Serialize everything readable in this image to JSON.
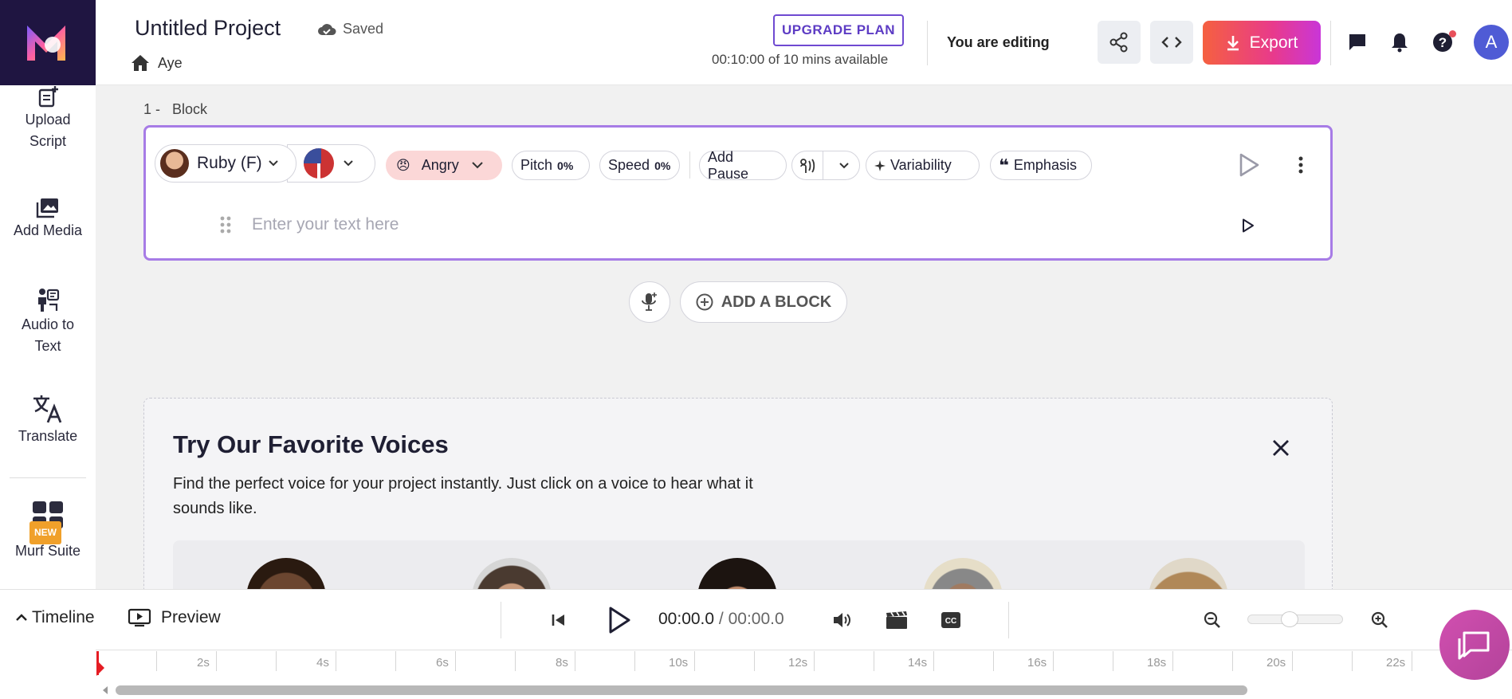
{
  "header": {
    "project_title": "Untitled Project",
    "saved_label": "Saved",
    "workspace": "Aye",
    "upgrade_label": "UPGRADE PLAN",
    "minutes": "00:10:00 of 10 mins available",
    "editing_label": "You are editing",
    "export_label": "Export",
    "avatar_letter": "A"
  },
  "sidebar": {
    "items": [
      {
        "label": "Upload Script",
        "icon": "upload-script-icon"
      },
      {
        "label": "Add Media",
        "icon": "add-media-icon"
      },
      {
        "label": "Audio to Text",
        "icon": "audio-to-text-icon"
      },
      {
        "label": "Translate",
        "icon": "translate-icon"
      },
      {
        "label": "Murf Suite",
        "icon": "murf-suite-icon",
        "badge": "NEW"
      }
    ]
  },
  "block": {
    "label_index": "1 -",
    "label": "Block",
    "voice_name": "Ruby (F)",
    "style": "Angry",
    "pitch_label": "Pitch",
    "pitch_value": "0%",
    "speed_label": "Speed",
    "speed_value": "0%",
    "pause_label": "Add Pause",
    "variability_label": "Variability",
    "emphasis_label": "Emphasis",
    "text_placeholder": "Enter your text here"
  },
  "add_block_label": "ADD A BLOCK",
  "favorites": {
    "title": "Try Our Favorite Voices",
    "description": "Find the perfect voice for your project instantly. Just click on a voice to hear what it sounds like."
  },
  "timeline": {
    "toggle_label": "Timeline",
    "preview_label": "Preview",
    "current_time": "00:00.0",
    "separator": " / ",
    "total_time": "00:00.0",
    "ticks": [
      "2s",
      "4s",
      "6s",
      "8s",
      "10s",
      "12s",
      "14s",
      "16s",
      "18s",
      "20s",
      "22s"
    ]
  },
  "colors": {
    "accent_purple": "#a77ce6",
    "logo_bg": "#1f1541",
    "export_gradient_start": "#f56040",
    "export_gradient_end": "#c936d8",
    "angry_bg": "#fbd7d7"
  }
}
